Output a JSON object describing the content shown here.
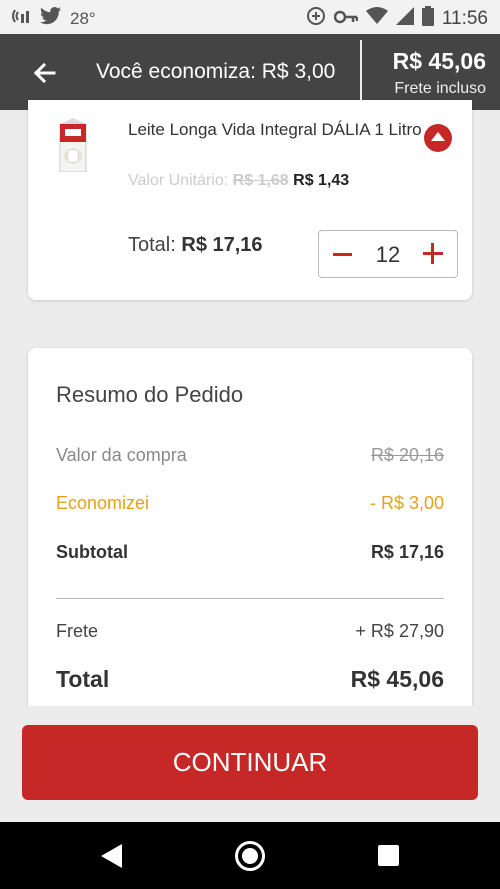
{
  "status_bar": {
    "temperature": "28°",
    "time": "11:56",
    "icons": [
      "hotspot-icon",
      "twitter-icon",
      "data-saver-icon",
      "vpn-key-icon",
      "wifi-icon",
      "signal-icon",
      "battery-icon"
    ]
  },
  "app_bar": {
    "economy_text": "Você economiza: R$ 3,00",
    "total": "R$ 45,06",
    "total_sub": "Frete incluso"
  },
  "product": {
    "name": "Leite Longa Vida Integral DÁLIA 1 Litro",
    "unit_label": "Valor Unitário:",
    "unit_old": "R$ 1,68",
    "unit_new": "R$ 1,43",
    "total_label": "Total:",
    "total_value": "R$ 17,16",
    "quantity": "12"
  },
  "summary": {
    "title": "Resumo do Pedido",
    "purchase_label": "Valor da compra",
    "purchase_value": "R$ 20,16",
    "saved_label": "Economizei",
    "saved_value": "- R$ 3,00",
    "subtotal_label": "Subtotal",
    "subtotal_value": "R$ 17,16",
    "shipping_label": "Frete",
    "shipping_value": "+ R$ 27,90",
    "total_label": "Total",
    "total_value": "R$ 45,06"
  },
  "actions": {
    "continue_label": "CONTINUAR"
  },
  "colors": {
    "primary": "#c62828",
    "appbar": "#444444",
    "discount": "#e6a11a",
    "background": "#ececec"
  }
}
